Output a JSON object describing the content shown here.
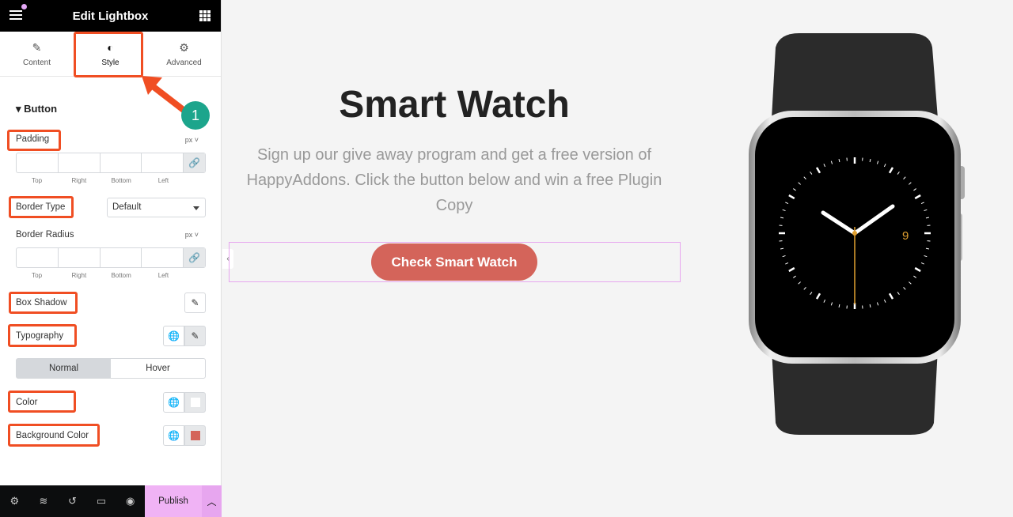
{
  "header": {
    "title": "Edit Lightbox"
  },
  "tabs": [
    {
      "label": "Content",
      "icon": "pencil-icon"
    },
    {
      "label": "Style",
      "icon": "contrast-icon"
    },
    {
      "label": "Advanced",
      "icon": "gear-icon"
    }
  ],
  "annotation": {
    "step": "1"
  },
  "section": {
    "title": "Button"
  },
  "controls": {
    "padding": "Padding",
    "unit": "px",
    "border_type": "Border Type",
    "border_type_value": "Default",
    "border_radius": "Border Radius",
    "box_shadow": "Box Shadow",
    "typography": "Typography",
    "color": "Color",
    "background_color": "Background Color",
    "dims": [
      "Top",
      "Right",
      "Bottom",
      "Left"
    ],
    "state_tabs": [
      "Normal",
      "Hover"
    ],
    "color_value": "#ffffff",
    "background_color_value": "#d4645a"
  },
  "footer": {
    "publish": "Publish"
  },
  "canvas": {
    "title": "Smart Watch",
    "description": "Sign up our give away program and get a free version of HappyAddons. Click the button below and win a free Plugin Copy",
    "button": "Check Smart Watch",
    "watch_number": "9"
  },
  "colors": {
    "accent": "#f0b3f5",
    "highlight": "#f04e23",
    "button": "#d4645a",
    "badge": "#1ca58c"
  }
}
